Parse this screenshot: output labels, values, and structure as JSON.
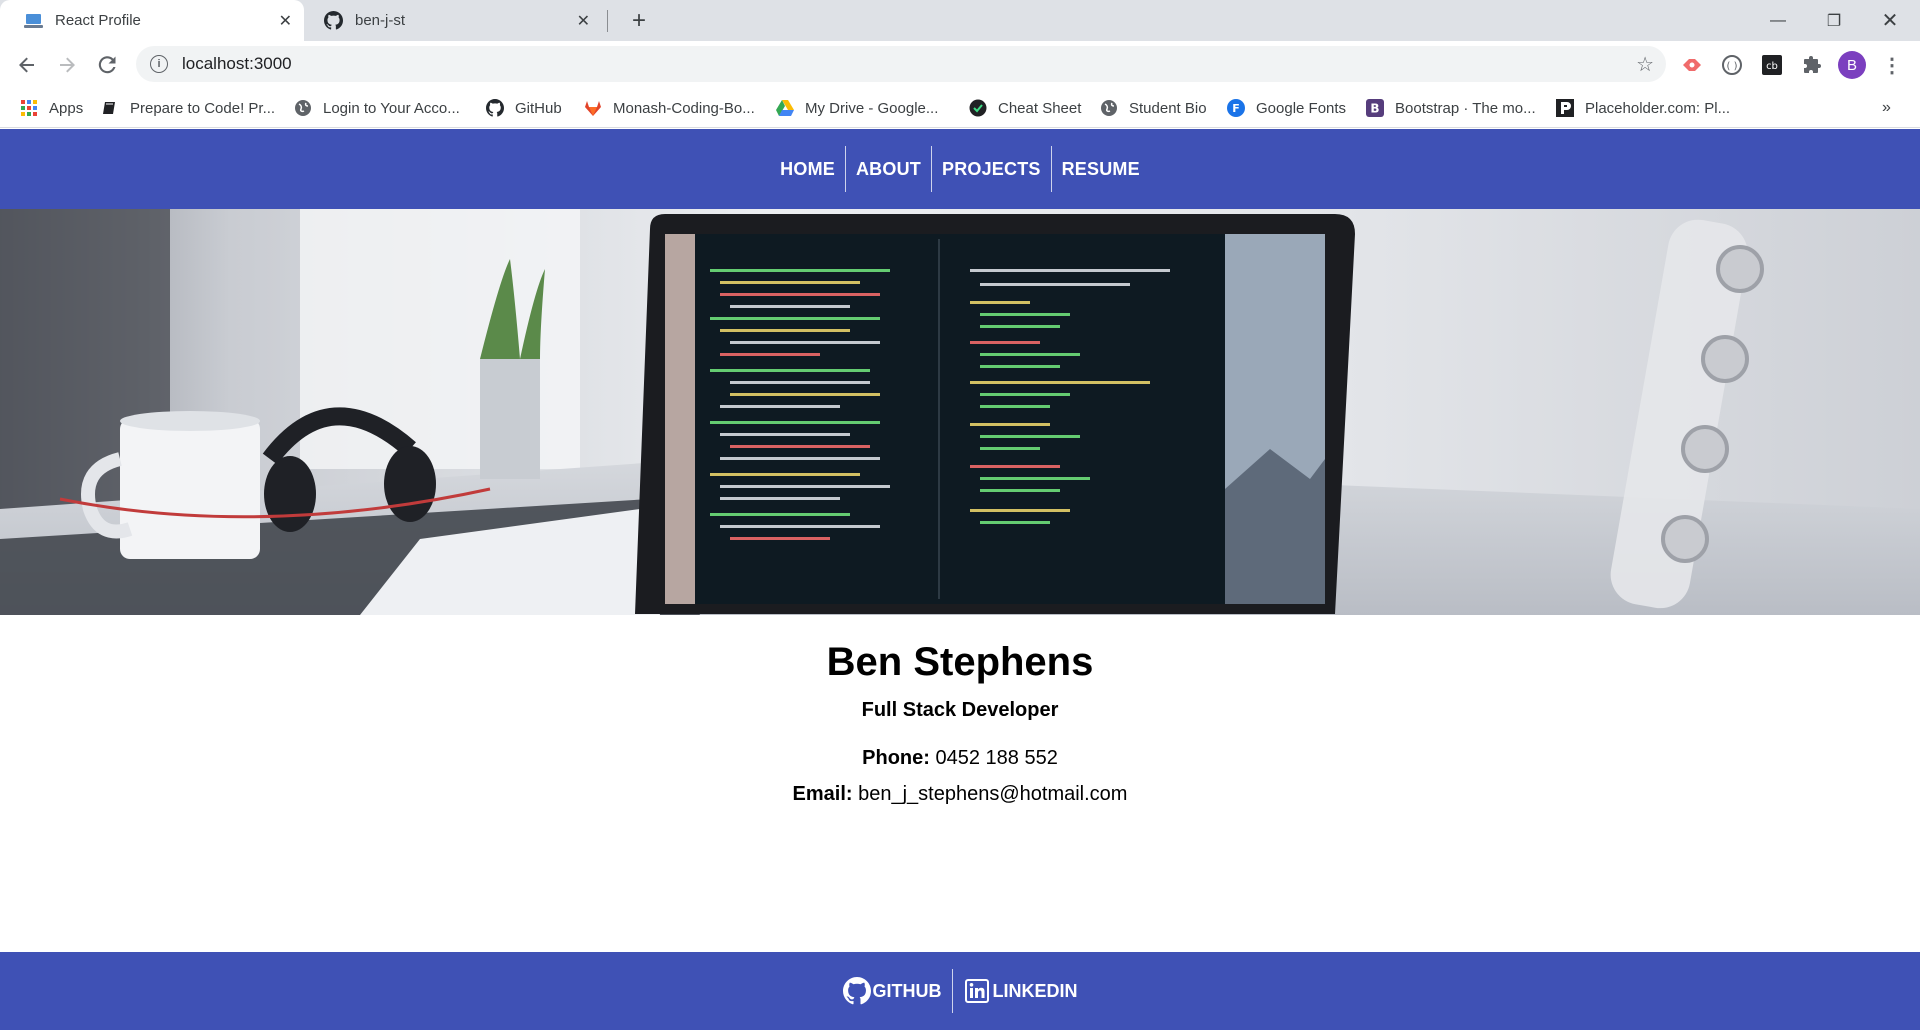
{
  "browser": {
    "tabs": [
      {
        "title": "React Profile",
        "active": true,
        "icon": "laptop-icon"
      },
      {
        "title": "ben-j-st",
        "active": false,
        "icon": "github-icon"
      }
    ],
    "url": "localhost:3000",
    "profile_initial": "B",
    "bookmarks": [
      {
        "label": "Apps",
        "icon": "apps-grid-icon"
      },
      {
        "label": "Prepare to Code! Pr...",
        "icon": "book-icon"
      },
      {
        "label": "Login to Your Acco...",
        "icon": "globe-icon"
      },
      {
        "label": "GitHub",
        "icon": "github-icon"
      },
      {
        "label": "Monash-Coding-Bo...",
        "icon": "gitlab-icon"
      },
      {
        "label": "My Drive - Google...",
        "icon": "google-drive-icon"
      },
      {
        "label": "Cheat Sheet",
        "icon": "cheat-sheet-icon"
      },
      {
        "label": "Student Bio",
        "icon": "globe-icon"
      },
      {
        "label": "Google Fonts",
        "icon": "google-fonts-icon"
      },
      {
        "label": "Bootstrap · The mo...",
        "icon": "bootstrap-icon"
      },
      {
        "label": "Placeholder.com: Pl...",
        "icon": "placeholder-icon"
      }
    ],
    "bookmarks_overflow": "»"
  },
  "nav": {
    "items": [
      "HOME",
      "ABOUT",
      "PROJECTS",
      "RESUME"
    ]
  },
  "profile": {
    "name": "Ben Stephens",
    "role": "Full Stack Developer",
    "phone_label": "Phone:",
    "phone_value": " 0452 188 552",
    "email_label": "Email:",
    "email_value": " ben_j_stephens@hotmail.com"
  },
  "footer": {
    "links": [
      {
        "label": "GITHUB",
        "icon": "github-icon"
      },
      {
        "label": "LINKEDIN",
        "icon": "linkedin-icon"
      }
    ]
  },
  "colors": {
    "primary": "#3f51b5",
    "chrome_tabbar": "#dee1e6",
    "profile_avatar": "#7b3fbf"
  }
}
